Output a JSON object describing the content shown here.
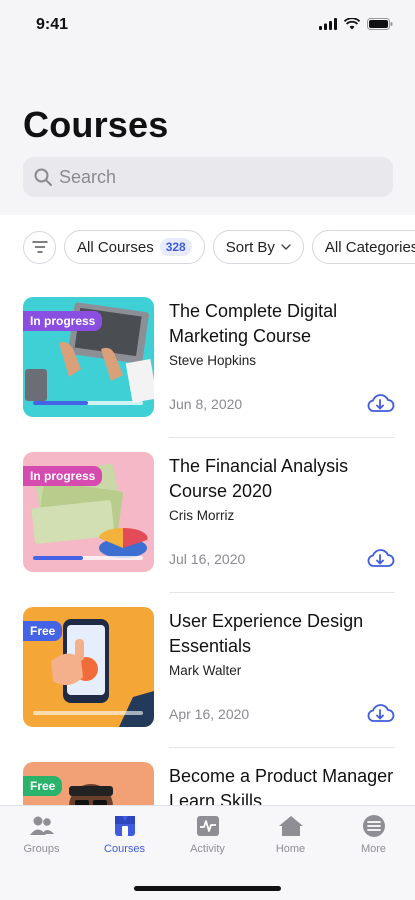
{
  "status_bar": {
    "time": "9:41"
  },
  "header": {
    "title": "Courses",
    "search_placeholder": "Search"
  },
  "filters": {
    "all_courses_label": "All Courses",
    "all_courses_count": "328",
    "sort_label": "Sort By",
    "category_label": "All Categories"
  },
  "courses": [
    {
      "title": "The Complete Digital Marketing Course",
      "author": "Steve Hopkins",
      "date": "Jun 8, 2020",
      "badge": "In progress",
      "badge_color": "#8a4fe0",
      "progress": 0.5
    },
    {
      "title": "The Financial Analysis Course 2020",
      "author": "Cris Morriz",
      "date": "Jul 16, 2020",
      "badge": "In progress",
      "badge_color": "#d64bb0",
      "progress": 0.45
    },
    {
      "title": "User Experience Design Essentials",
      "author": "Mark Walter",
      "date": "Apr 16, 2020",
      "badge": "Free",
      "badge_color": "#4463e6",
      "progress": 0
    },
    {
      "title": "Become a Product Manager Learn Skills",
      "badge": "Free",
      "badge_color": "#2ab36a"
    }
  ],
  "tab_bar": {
    "tabs": [
      {
        "label": "Groups",
        "icon": "groups-icon",
        "active": false
      },
      {
        "label": "Courses",
        "icon": "courses-icon",
        "active": true
      },
      {
        "label": "Activity",
        "icon": "activity-icon",
        "active": false
      },
      {
        "label": "Home",
        "icon": "home-icon",
        "active": false
      },
      {
        "label": "More",
        "icon": "more-icon",
        "active": false
      }
    ]
  },
  "colors": {
    "accent": "#3f5ce0"
  }
}
